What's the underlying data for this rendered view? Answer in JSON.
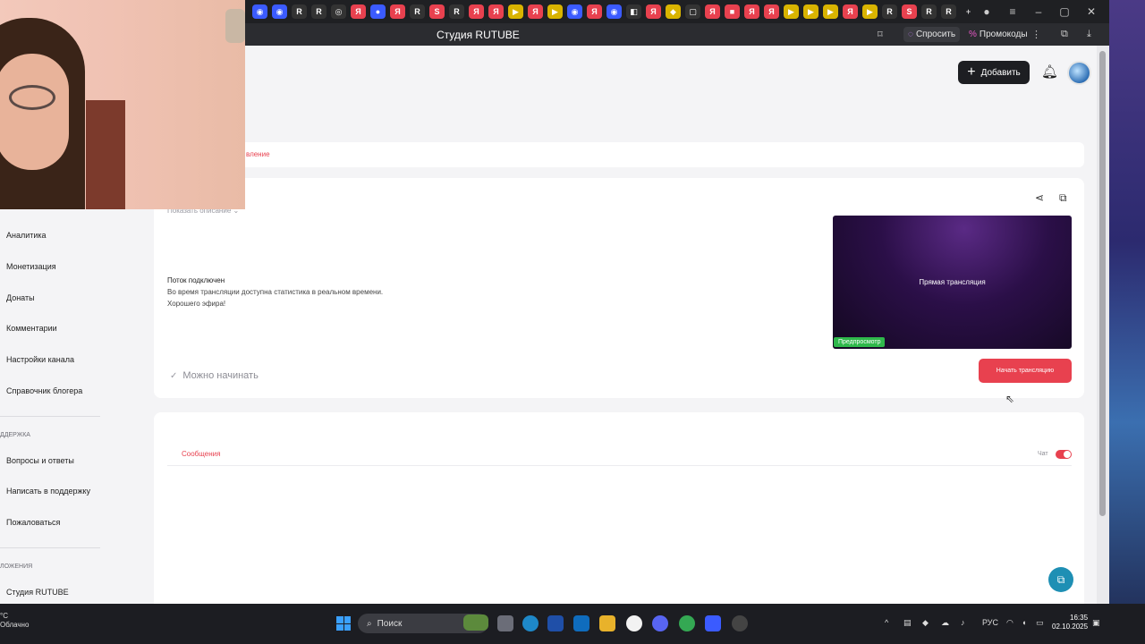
{
  "browser": {
    "tab_icons": [
      {
        "color": "#3b5bff",
        "glyph": "◉"
      },
      {
        "color": "#3b5bff",
        "glyph": "◉"
      },
      {
        "color": "#333",
        "glyph": "R"
      },
      {
        "color": "#333",
        "glyph": "R"
      },
      {
        "color": "#333",
        "glyph": "◎"
      },
      {
        "color": "#e8414f",
        "glyph": "Я"
      },
      {
        "color": "#3b5bff",
        "glyph": "●"
      },
      {
        "color": "#e8414f",
        "glyph": "Я"
      },
      {
        "color": "#333",
        "glyph": "R"
      },
      {
        "color": "#e8414f",
        "glyph": "S"
      },
      {
        "color": "#333",
        "glyph": "R"
      },
      {
        "color": "#e8414f",
        "glyph": "Я"
      },
      {
        "color": "#e8414f",
        "glyph": "Я"
      },
      {
        "color": "#d9b400",
        "glyph": "▶"
      },
      {
        "color": "#e8414f",
        "glyph": "Я"
      },
      {
        "color": "#d9b400",
        "glyph": "▶"
      },
      {
        "color": "#3b5bff",
        "glyph": "◉"
      },
      {
        "color": "#e8414f",
        "glyph": "Я"
      },
      {
        "color": "#3b5bff",
        "glyph": "◉"
      },
      {
        "color": "#333",
        "glyph": "◧"
      },
      {
        "color": "#e8414f",
        "glyph": "Я"
      },
      {
        "color": "#d9b400",
        "glyph": "◆"
      },
      {
        "color": "#333",
        "glyph": "▢"
      },
      {
        "color": "#e8414f",
        "glyph": "Я"
      },
      {
        "color": "#e8414f",
        "glyph": "■"
      },
      {
        "color": "#e8414f",
        "glyph": "Я"
      },
      {
        "color": "#e8414f",
        "glyph": "Я"
      },
      {
        "color": "#d9b400",
        "glyph": "▶"
      },
      {
        "color": "#d9b400",
        "glyph": "▶"
      },
      {
        "color": "#d9b400",
        "glyph": "▶"
      },
      {
        "color": "#e8414f",
        "glyph": "Я"
      },
      {
        "color": "#d9b400",
        "glyph": "▶"
      },
      {
        "color": "#333",
        "glyph": "R"
      },
      {
        "color": "#e8414f",
        "glyph": "S"
      },
      {
        "color": "#333",
        "glyph": "R"
      },
      {
        "color": "#333",
        "glyph": "R"
      }
    ],
    "page_title": "Студия RUTUBE",
    "ask_label": "Спросить",
    "promo_label": "Промокоды"
  },
  "header": {
    "add_label": "Добавить"
  },
  "tabs": {
    "active_partial": "вление"
  },
  "stream": {
    "show_description": "Показать описание",
    "status_title": "Поток подключен",
    "status_lines": [
      "Во время трансляции доступна статистика в реальном времени.",
      "Хорошего эфира!"
    ],
    "ready_label": "Можно начинать",
    "preview_title": "Прямая трансляция",
    "preview_badge": "Предпросмотр",
    "start_label": "Начать трансляцию"
  },
  "chat": {
    "tab_label": "Сообщения",
    "chat_label": "Чат",
    "chat_enabled": true
  },
  "sidebar": {
    "items": [
      "Аналитика",
      "Монетизация",
      "Донаты",
      "Комментарии",
      "Настройки канала",
      "Справочник блогера"
    ],
    "support_heading": "ДДЕРЖКА",
    "support_items": [
      "Вопросы и ответы",
      "Написать в поддержку",
      "Пожаловаться"
    ],
    "apps_heading": "ЛОЖЕНИЯ",
    "apps_items": [
      "Студия RUTUBE"
    ]
  },
  "taskbar": {
    "weather_temp": "°C",
    "weather_desc": "Облачно",
    "search_label": "Поиск",
    "lang": "РУС",
    "time": "16:35",
    "date": "02.10.2025"
  }
}
